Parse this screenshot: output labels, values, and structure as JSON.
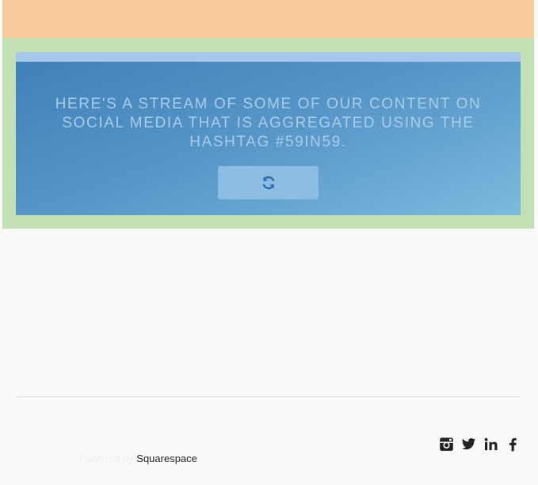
{
  "hero": {
    "text": "HERE'S A STREAM OF SOME OF OUR CONTENT ON SOCIAL MEDIA THAT IS AGGREGATED USING THE HASHTAG #59IN59.",
    "refresh_icon": "refresh-icon"
  },
  "footer": {
    "powered_prefix": "Powered by",
    "powered_brand": "Squarespace",
    "social": [
      {
        "name": "instagram",
        "icon": "instagram-icon"
      },
      {
        "name": "twitter",
        "icon": "twitter-icon"
      },
      {
        "name": "linkedin",
        "icon": "linkedin-icon"
      },
      {
        "name": "facebook",
        "icon": "facebook-icon"
      }
    ]
  },
  "colors": {
    "top_band": "#f8cb9c",
    "green_band": "#c3dfb4",
    "hero_blue": "#4a8ac1",
    "button": "#8ebde3"
  }
}
